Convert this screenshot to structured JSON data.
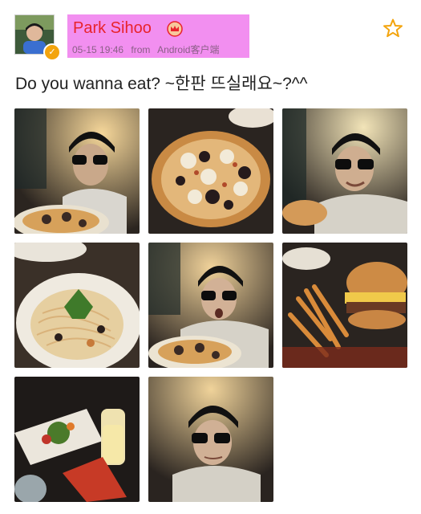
{
  "post": {
    "author": "Park Sihoo",
    "date": "05-15 19:46",
    "source_prefix": "from",
    "source": "Android客户端",
    "text": "Do you wanna eat? ~한판 뜨실래요~?^^",
    "verified_icon": "check-badge-icon",
    "favorite_icon": "star-outline-icon",
    "crown_icon": "crown-icon"
  },
  "colors": {
    "name_highlight": "#f28ff0",
    "name_text": "#e8232b",
    "star": "#f3a40d",
    "badge": "#f3a40d"
  },
  "photos": [
    {
      "subject": "man-with-pizza"
    },
    {
      "subject": "pizza-closeup"
    },
    {
      "subject": "man-smiling-eating"
    },
    {
      "subject": "spaghetti-plate"
    },
    {
      "subject": "man-surprised-pizza"
    },
    {
      "subject": "hamburger-fries"
    },
    {
      "subject": "table-food-drink"
    },
    {
      "subject": "man-selfie"
    }
  ]
}
